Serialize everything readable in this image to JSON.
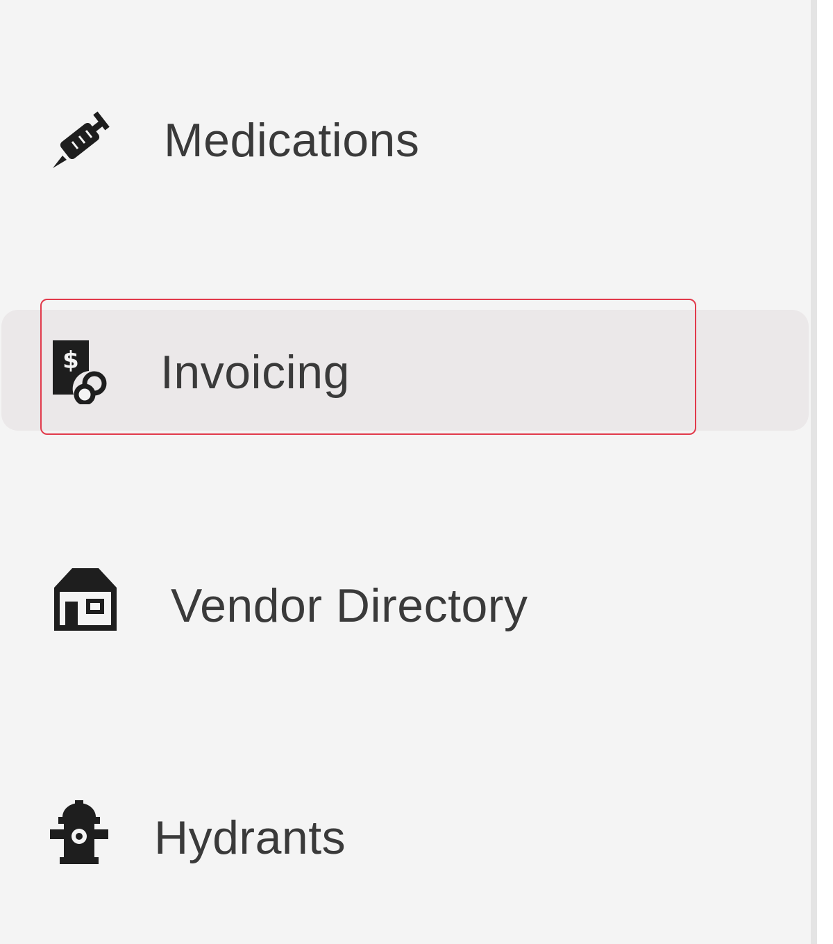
{
  "sidebar": {
    "items": [
      {
        "label": "Medications",
        "icon": "syringe-icon",
        "active": false
      },
      {
        "label": "Invoicing",
        "icon": "invoice-icon",
        "active": true
      },
      {
        "label": "Vendor Directory",
        "icon": "house-icon",
        "active": false
      },
      {
        "label": "Hydrants",
        "icon": "fire-hydrant-icon",
        "active": false
      }
    ]
  },
  "colors": {
    "sidebar_background": "#f4f4f4",
    "active_item_background": "#ebe8e9",
    "focus_outline": "#e13a4b",
    "label_text": "#3a3a3a",
    "icon": "#1e1e1e"
  }
}
